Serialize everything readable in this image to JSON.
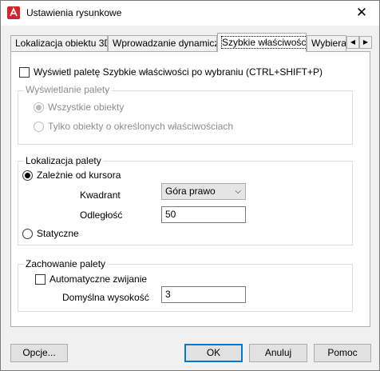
{
  "window": {
    "title": "Ustawienia rysunkowe",
    "close_glyph": "✕"
  },
  "tabs": [
    {
      "label": "Lokalizacja obiektu 3D",
      "active": false
    },
    {
      "label": "Wprowadzanie dynamiczne",
      "active": false
    },
    {
      "label": "Szybkie właściwości",
      "active": true
    },
    {
      "label": "Wybierani",
      "active": false
    }
  ],
  "tab_scroll": {
    "left": "◀",
    "right": "▶"
  },
  "panel": {
    "show_palette": {
      "checked": false,
      "label": "Wyświetl paletę Szybkie właściwości po wybraniu (CTRL+SHIFT+P)"
    },
    "palette_display": {
      "title": "Wyświetlanie palety",
      "options": [
        {
          "label": "Wszystkie obiekty",
          "selected": true,
          "enabled": false
        },
        {
          "label": "Tylko obiekty o określonych właściwościach",
          "selected": false,
          "enabled": false
        }
      ]
    },
    "palette_location": {
      "title": "Lokalizacja palety",
      "cursor_dependent": {
        "label": "Zależnie od kursora",
        "selected": true
      },
      "quadrant_label": "Kwadrant",
      "quadrant_value": "Góra prawo",
      "distance_label": "Odległość",
      "distance_value": "50",
      "static": {
        "label": "Statyczne",
        "selected": false
      }
    },
    "palette_behavior": {
      "title": "Zachowanie palety",
      "auto_collapse": {
        "label": "Automatyczne zwijanie",
        "checked": false
      },
      "default_height_label": "Domyślna wysokość",
      "default_height_value": "3"
    }
  },
  "buttons": {
    "options": "Opcje...",
    "ok": "OK",
    "cancel": "Anuluj",
    "help": "Pomoc"
  }
}
